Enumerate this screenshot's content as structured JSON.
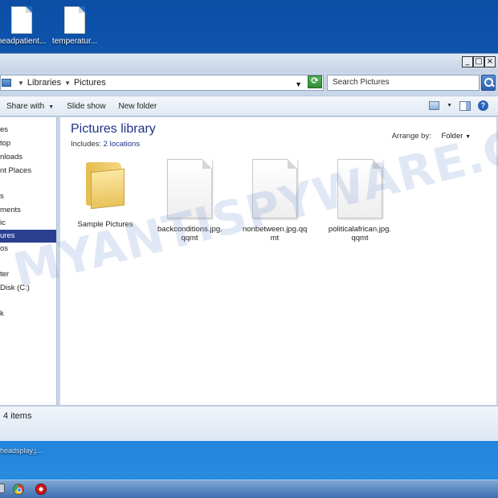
{
  "desktop": {
    "icons": [
      {
        "label": "headpatient..."
      },
      {
        "label": "temperatur..."
      }
    ],
    "partial_label": "headsplay.j..."
  },
  "window": {
    "buttons": {
      "minimize": "_",
      "maximize": "□",
      "close": "×"
    },
    "address": {
      "crumbs": [
        "Libraries",
        "Pictures"
      ],
      "refresh_symbol": "⟳"
    },
    "search": {
      "placeholder": "Search Pictures"
    },
    "toolbar": {
      "share_with": "Share with",
      "slide_show": "Slide show",
      "new_folder": "New folder"
    },
    "nav": {
      "items": [
        {
          "label": "es"
        },
        {
          "label": "top"
        },
        {
          "label": "nloads"
        },
        {
          "label": "nt Places"
        },
        {
          "label": "s"
        },
        {
          "label": "ments"
        },
        {
          "label": "ic"
        },
        {
          "label": "ures",
          "selected": true
        },
        {
          "label": "os"
        },
        {
          "label": "ter"
        },
        {
          "label": "Disk (C:)"
        },
        {
          "label": "k"
        }
      ]
    },
    "library": {
      "title": "Pictures library",
      "includes_label": "Includes:",
      "includes_value": "2 locations",
      "arrange_label": "Arrange by:",
      "arrange_value": "Folder"
    },
    "items": [
      {
        "name": "Sample Pictures",
        "kind": "folder"
      },
      {
        "name": "backconditions.jpg.\nqqmt",
        "kind": "file"
      },
      {
        "name": "nonbetween.jpg.qq\nmt",
        "kind": "file"
      },
      {
        "name": "politicalafrican.jpg.\nqqmt",
        "kind": "file"
      }
    ],
    "status": {
      "count": "4 items"
    }
  },
  "watermark": "MYANTISPYWARE.COM",
  "colors": {
    "desktop": "#1566c4",
    "library_title": "#1e3287",
    "nav_selected": "#2a3f8f"
  }
}
